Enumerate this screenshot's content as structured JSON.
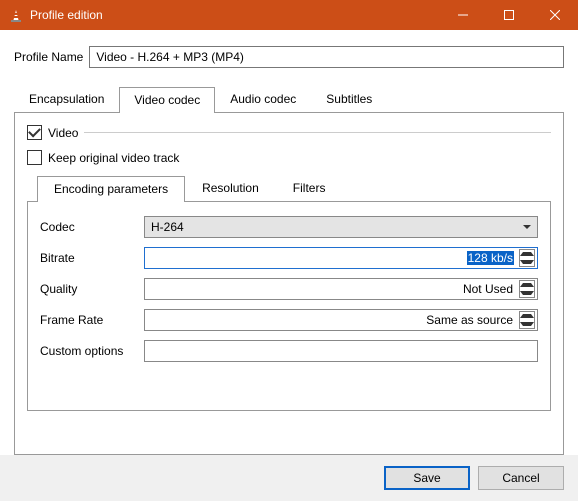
{
  "window": {
    "title": "Profile edition"
  },
  "profile": {
    "label": "Profile Name",
    "value": "Video - H.264 + MP3 (MP4)"
  },
  "tabs_outer": [
    "Encapsulation",
    "Video codec",
    "Audio codec",
    "Subtitles"
  ],
  "group": {
    "video_label": "Video",
    "keep_label": "Keep original video track"
  },
  "tabs_inner": [
    "Encoding parameters",
    "Resolution",
    "Filters"
  ],
  "form": {
    "codec": {
      "label": "Codec",
      "value": "H-264"
    },
    "bitrate": {
      "label": "Bitrate",
      "value": "128 kb/s"
    },
    "quality": {
      "label": "Quality",
      "value": "Not Used"
    },
    "framerate": {
      "label": "Frame Rate",
      "value": "Same as source"
    },
    "custom": {
      "label": "Custom options",
      "value": ""
    }
  },
  "footer": {
    "save": "Save",
    "cancel": "Cancel"
  }
}
